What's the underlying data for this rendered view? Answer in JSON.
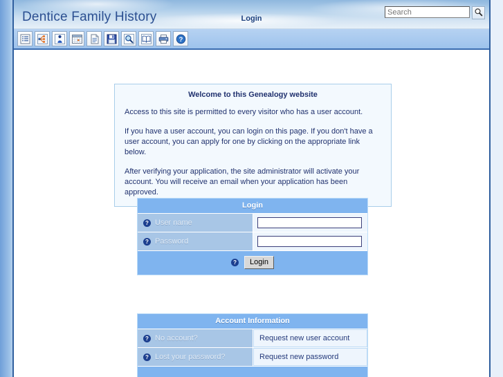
{
  "header": {
    "site_title": "Dentice Family History",
    "page_label": "Login",
    "search_placeholder": "Search",
    "search_value": "",
    "search_button_icon": "magnifier-icon"
  },
  "toolbar": {
    "buttons": [
      {
        "name": "surname-list-button",
        "icon": "list-icon",
        "title": "Surnames"
      },
      {
        "name": "pedigree-chart-button",
        "icon": "tree-chart-icon",
        "title": "Pedigree chart"
      },
      {
        "name": "individuals-button",
        "icon": "person-icon",
        "title": "Individuals"
      },
      {
        "name": "calendar-button",
        "icon": "calendar-icon",
        "title": "Calendar"
      },
      {
        "name": "reports-button",
        "icon": "document-icon",
        "title": "Reports"
      },
      {
        "name": "save-gedcom-button",
        "icon": "floppy-disk-icon",
        "title": "Save"
      },
      {
        "name": "search-button",
        "icon": "magnifier-icon",
        "title": "Search"
      },
      {
        "name": "sources-button",
        "icon": "book-icon",
        "title": "Sources"
      },
      {
        "name": "print-button",
        "icon": "printer-icon",
        "title": "Print"
      },
      {
        "name": "help-button",
        "icon": "question-mark-icon",
        "title": "Help"
      }
    ]
  },
  "welcome": {
    "title": "Welcome to this Genealogy website",
    "paragraphs": [
      "Access to this site is permitted to every visitor who has a user account.",
      "If you have a user account, you can login on this page. If you don't have a user account, you can apply for one by clicking on the appropriate link below.",
      "After verifying your application, the site administrator will activate your account. You will receive an email when your application has been approved."
    ]
  },
  "login_panel": {
    "title": "Login",
    "username_label": "User name",
    "username_value": "",
    "password_label": "Password",
    "password_value": "",
    "submit_label": "Login",
    "help_glyph": "?"
  },
  "account_panel": {
    "title": "Account Information",
    "rows": [
      {
        "label": "No account?",
        "link": "Request new user account"
      },
      {
        "label": "Lost your password?",
        "link": "Request new password"
      }
    ]
  },
  "colors": {
    "header_blue": "#2b4f91",
    "panel_title_bg": "#7fb4ef",
    "label_cell_bg": "#a8c6e6",
    "field_cell_bg": "#eef5fd",
    "frame_border": "#2e5e9e",
    "text_navy": "#20316e"
  }
}
